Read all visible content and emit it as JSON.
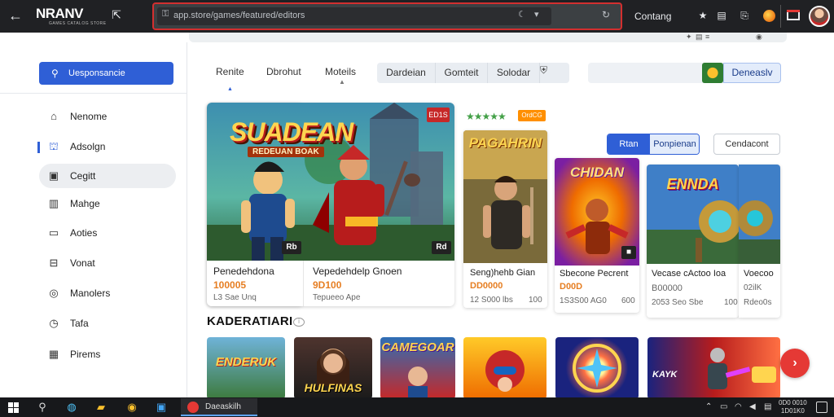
{
  "browser": {
    "logo": "NRANV",
    "logo_sub": "GAMES CATALOG STORE",
    "address": "app.store/games/featured/editors",
    "right_label": "Contang"
  },
  "sidebar": {
    "search_label": "Uesponsancie",
    "items": [
      {
        "label": "Nenome",
        "icon": "home-icon"
      },
      {
        "label": "Adsolgn",
        "icon": "store-icon"
      },
      {
        "label": "Cegitt",
        "icon": "grid-icon"
      },
      {
        "label": "Mahge",
        "icon": "book-icon"
      },
      {
        "label": "Aoties",
        "icon": "doc-icon"
      },
      {
        "label": "Vonat",
        "icon": "inbox-icon"
      },
      {
        "label": "Manolers",
        "icon": "circle-icon"
      },
      {
        "label": "Tafa",
        "icon": "clock-icon"
      },
      {
        "label": "Pirems",
        "icon": "calendar-icon"
      }
    ]
  },
  "tabs": {
    "items": [
      "Renite",
      "Dbrohut",
      "Moteils"
    ],
    "segments": [
      "Dardeian",
      "Gomteit",
      "Solodar"
    ],
    "filter_button": "Deneaslv"
  },
  "featured": {
    "title_art": "SUADEAN",
    "title_sub": "REDEUAN BOAK",
    "tag": "ED1S",
    "card1": {
      "title": "Penedehdona",
      "price": "100005",
      "meta": "L3 Sae Unq",
      "badge": "Rb"
    },
    "card2": {
      "title": "Vepedehdelp Gnoen",
      "price": "9D100",
      "meta": "Tepueeo Ape",
      "badge": "Rd"
    },
    "rating_badge": "OrdCG",
    "stars": "★★★★★"
  },
  "actions": {
    "primary": "Rtan",
    "secondary": "Ponpienan",
    "outline": "Cendacont"
  },
  "games": [
    {
      "logo": "PAGAHRIN",
      "title": "Seng)hehb Gian",
      "price": "DD0000",
      "meta_left": "12 S000 lbs",
      "meta_right": "100"
    },
    {
      "logo": "CHIDAN",
      "title": "Sbecone Pecrent",
      "price": "D00D",
      "meta_left": "1S3S00 AG0",
      "meta_right": "600"
    },
    {
      "logo": "ENNDA",
      "title": "Vecase cActoo Ioa",
      "price": "B00000",
      "meta_left": "2053 Seo Sbe",
      "meta_right": "100"
    },
    {
      "logo": "",
      "title": "Voecoo",
      "price": "02ilK",
      "meta_left": "Rdeo0s",
      "meta_right": ""
    }
  ],
  "section": {
    "title": "KADERATIARI",
    "thumbs": [
      "ENDERUK",
      "HULFINAS",
      "CAMEGOAR",
      "",
      "",
      "KAYK"
    ]
  },
  "taskbar": {
    "app_label": "Daeaskilh",
    "clock_time": "0D0 0010",
    "clock_date": "1D01K0"
  }
}
